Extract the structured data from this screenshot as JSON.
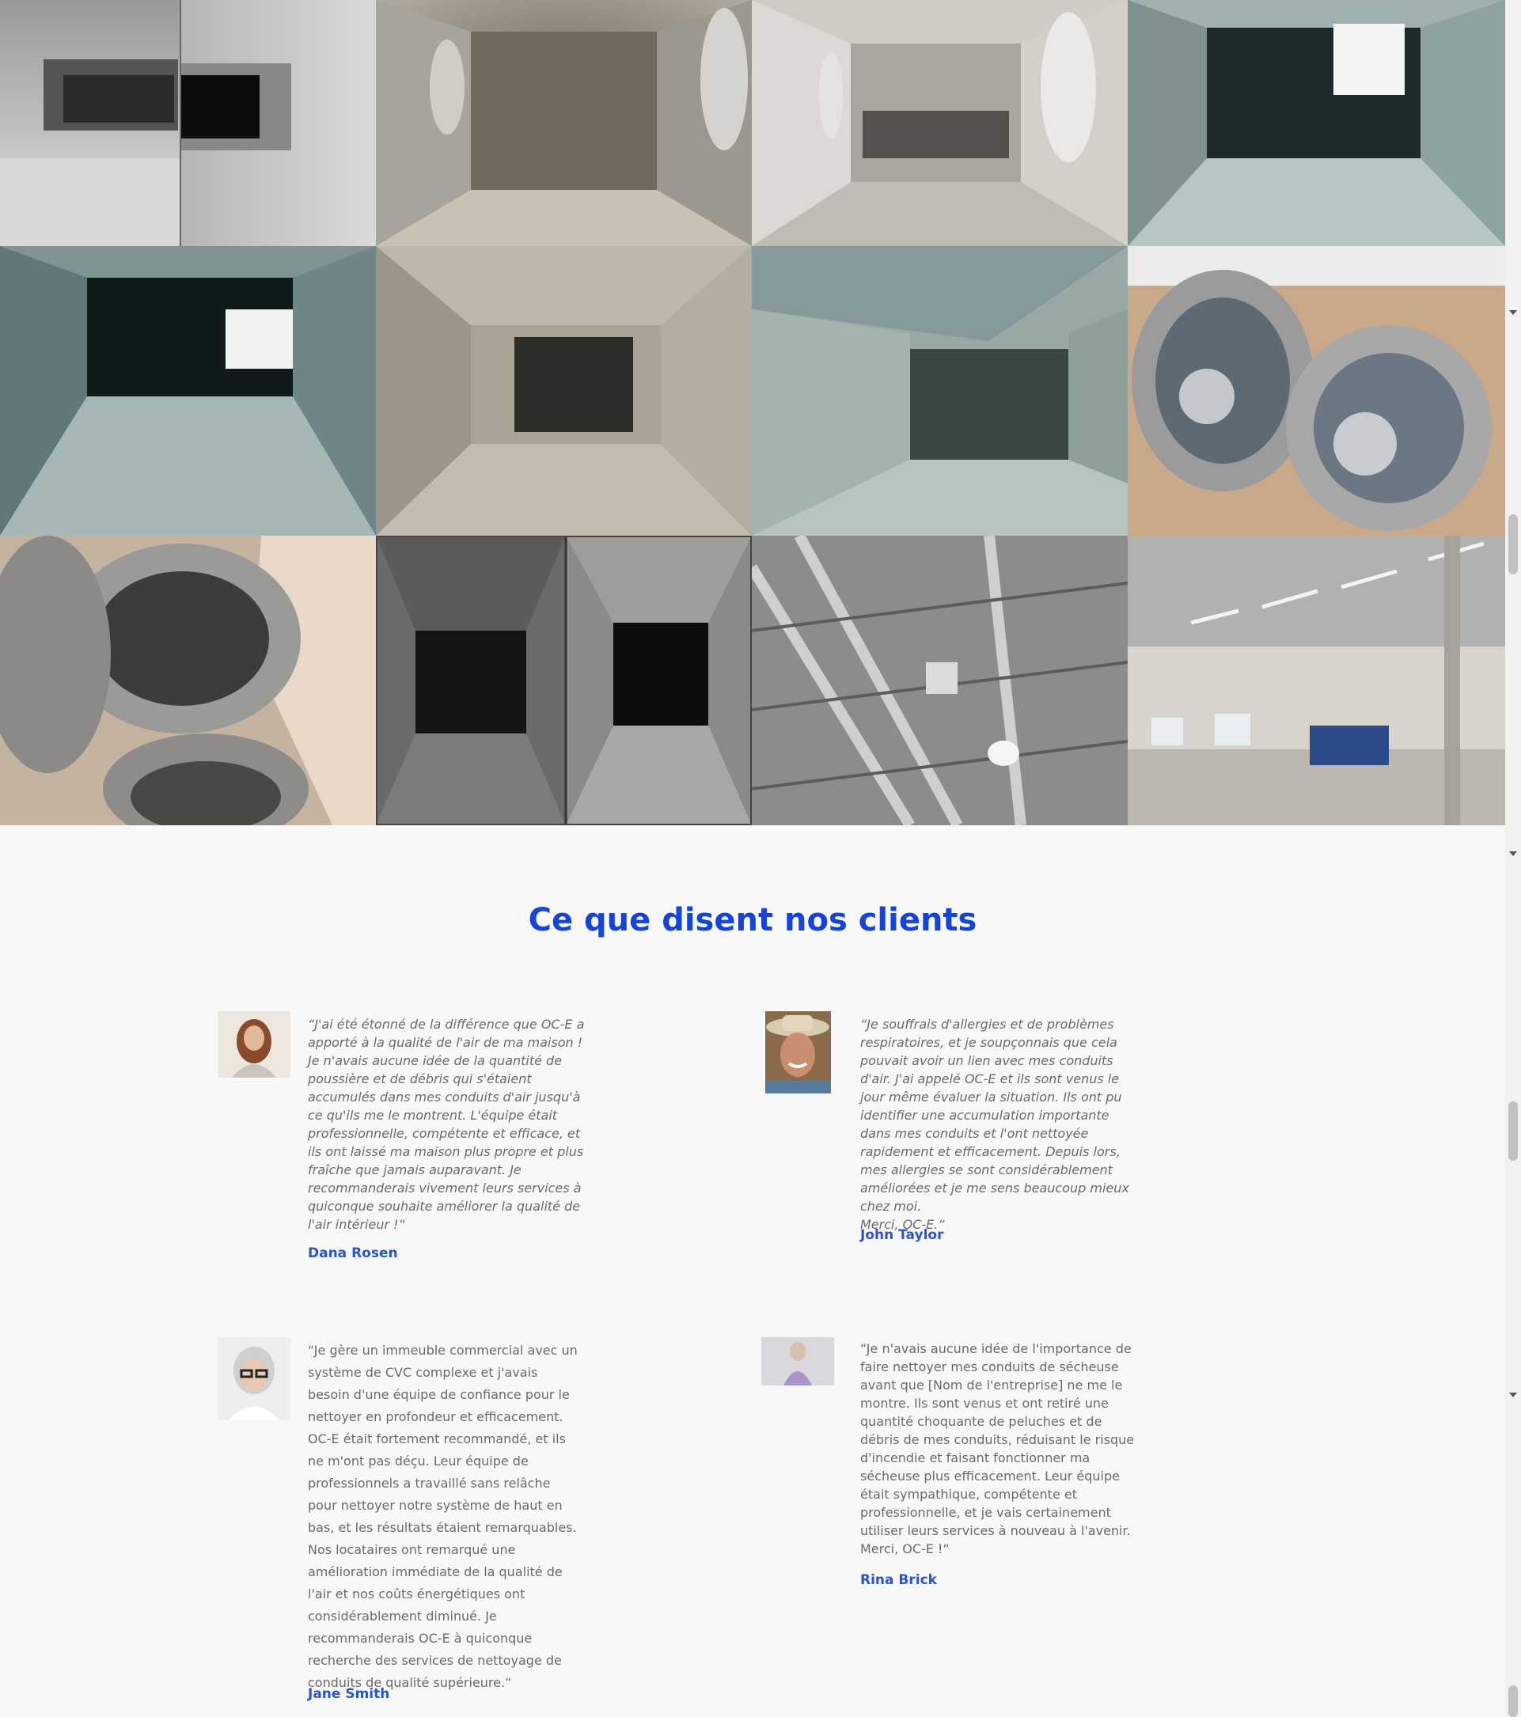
{
  "gallery": {
    "photos": [
      {
        "icon": "duct-before-after-photo"
      },
      {
        "icon": "duct-interior-photo"
      },
      {
        "icon": "duct-interior-clean-photo"
      },
      {
        "icon": "duct-metal-photo"
      },
      {
        "icon": "duct-metal-photo"
      },
      {
        "icon": "dusty-duct-photo"
      },
      {
        "icon": "duct-interior-photo"
      },
      {
        "icon": "flexible-duct-dusty-photo"
      },
      {
        "icon": "flexible-duct-photo"
      },
      {
        "icon": "duct-before-after-photo"
      },
      {
        "icon": "ceiling-ducts-photo"
      },
      {
        "icon": "warehouse-ducts-photo"
      }
    ]
  },
  "testimonials": {
    "title": "Ce que disent nos clients",
    "items": [
      {
        "quote": "“J'ai été étonné de la différence que OC-E a apporté à la qualité de l'air de ma maison ! Je n'avais aucune idée de la quantité de poussière et de débris qui s'étaient accumulés dans mes conduits d'air jusqu'à ce qu'ils me le montrent. L'équipe était professionnelle, compétente et efficace, et ils ont laissé ma maison plus propre et plus fraîche que jamais auparavant. Je recommanderais vivement leurs services à quiconque souhaite améliorer la qualité de l'air intérieur !“",
        "author": "Dana Rosen",
        "avatar": "woman-portrait-avatar"
      },
      {
        "quote": "“Je souffrais d'allergies et de problèmes respiratoires, et je soupçonnais que cela pouvait avoir un lien avec mes conduits d'air. J'ai appelé OC-E et ils sont venus le jour même évaluer la situation. Ils ont pu identifier une accumulation importante dans mes conduits et l'ont nettoyée rapidement et efficacement. Depuis lors, mes allergies se sont considérablement améliorées et je me sens beaucoup mieux chez moi.\nMerci, OC-E.“",
        "author": "John Taylor",
        "avatar": "man-cowboy-hat-avatar"
      },
      {
        "quote": "“Je gère un immeuble commercial avec un système de CVC complexe et j'avais besoin d'une équipe de confiance pour le nettoyer en profondeur et efficacement. OC-E était fortement recommandé, et ils ne m'ont pas déçu. Leur équipe de professionnels a travaillé sans relâche pour nettoyer notre système de haut en bas, et les résultats étaient remarquables. Nos locataires ont remarqué une amélioration immédiate de la qualité de l'air et nos coûts énergétiques ont considérablement diminué. Je recommanderais OC-E à quiconque recherche des services de nettoyage de conduits de qualité supérieure.“",
        "author": "Jane Smith",
        "avatar": "older-woman-glasses-avatar"
      },
      {
        "quote": "“Je n'avais aucune idée de l'importance de faire nettoyer mes conduits de sécheuse avant que [Nom de l'entreprise] ne me le montre. Ils sont venus et ont retiré une quantité choquante de peluches et de débris de mes conduits, réduisant le risque d'incendie et faisant fonctionner ma sécheuse plus efficacement. Leur équipe était sympathique, compétente et professionnelle, et je vais certainement utiliser leurs services à nouveau à l'avenir.\nMerci, OC-E !“",
        "author": "Rina Brick",
        "avatar": "woman-lavender-avatar"
      }
    ]
  },
  "colors": {
    "title": "#1544d6",
    "author": "#2b55c9",
    "body_text": "#6a6a6a",
    "background": "#f8f8f8"
  }
}
